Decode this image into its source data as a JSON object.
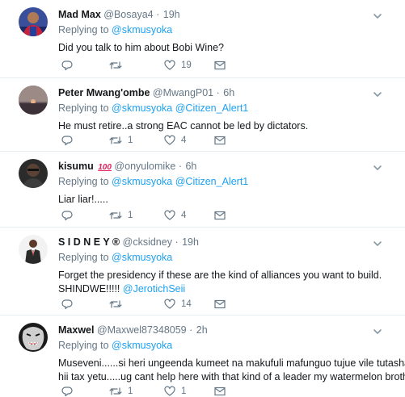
{
  "tweets": [
    {
      "name": "Mad Max",
      "handle": "@Bosaya4",
      "time": "19h",
      "replying_prefix": "Replying to",
      "mentions": [
        "@skmusyoka"
      ],
      "text_parts": [
        "Did you talk to him about Bobi Wine?"
      ],
      "reply_count": "",
      "retweet_count": "",
      "like_count": "19"
    },
    {
      "name": "Peter Mwang'ombe",
      "handle": "@MwangP01",
      "time": "6h",
      "replying_prefix": "Replying to",
      "mentions": [
        "@skmusyoka",
        "@Citizen_Alert1"
      ],
      "text_parts": [
        "He must retire..a strong EAC cannot be led by dictators."
      ],
      "reply_count": "",
      "retweet_count": "1",
      "like_count": "4"
    },
    {
      "name": "kisumu",
      "name_badge": "100",
      "handle": "@onyulomike",
      "time": "6h",
      "replying_prefix": "Replying to",
      "mentions": [
        "@skmusyoka",
        "@Citizen_Alert1"
      ],
      "text_parts": [
        "Liar liar!....."
      ],
      "reply_count": "",
      "retweet_count": "1",
      "like_count": "4"
    },
    {
      "name": "S I D N E Y ®",
      "handle": "@cksidney",
      "time": "19h",
      "replying_prefix": "Replying to",
      "mentions": [
        "@skmusyoka"
      ],
      "text_parts": [
        "Forget the presidency if these are the kind of alliances you want to build.",
        "SHINDWE!!!!! "
      ],
      "text_mention": "@JerotichSeii",
      "reply_count": "",
      "retweet_count": "",
      "like_count": "14"
    },
    {
      "name": "Maxwel",
      "handle": "@Maxwel87348059",
      "time": "2h",
      "replying_prefix": "Replying to",
      "mentions": [
        "@skmusyoka"
      ],
      "text_parts": [
        "Museveni......si heri ungeenda kumeet na makufuli mafunguo tujue vile tutashare",
        "hii tax yetu.....ug cant help here with that kind of a leader my watermelon brother"
      ],
      "reply_count": "",
      "retweet_count": "1",
      "like_count": "1"
    }
  ],
  "separator": "·",
  "icons": {
    "reply": "reply-icon",
    "retweet": "retweet-icon",
    "like": "heart-icon",
    "message": "envelope-icon",
    "more": "chevron-down-icon"
  },
  "colors": {
    "link": "#1da1f2",
    "muted": "#657786",
    "text": "#14171a",
    "divider": "#e6ecf0"
  }
}
